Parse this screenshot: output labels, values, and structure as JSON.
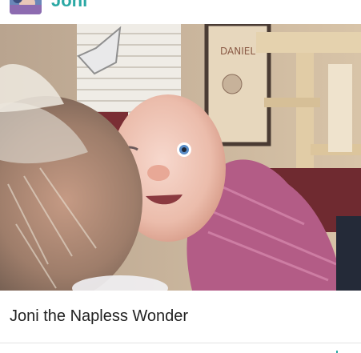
{
  "post": {
    "author": {
      "username": "Joni",
      "avatar_icon": "profile-photo",
      "accent_color": "#2aa8a4"
    },
    "photo": {
      "sign_text": "DANIEL"
    },
    "caption": "Joni the Napless Wonder",
    "footer_icon": "share-icon"
  }
}
